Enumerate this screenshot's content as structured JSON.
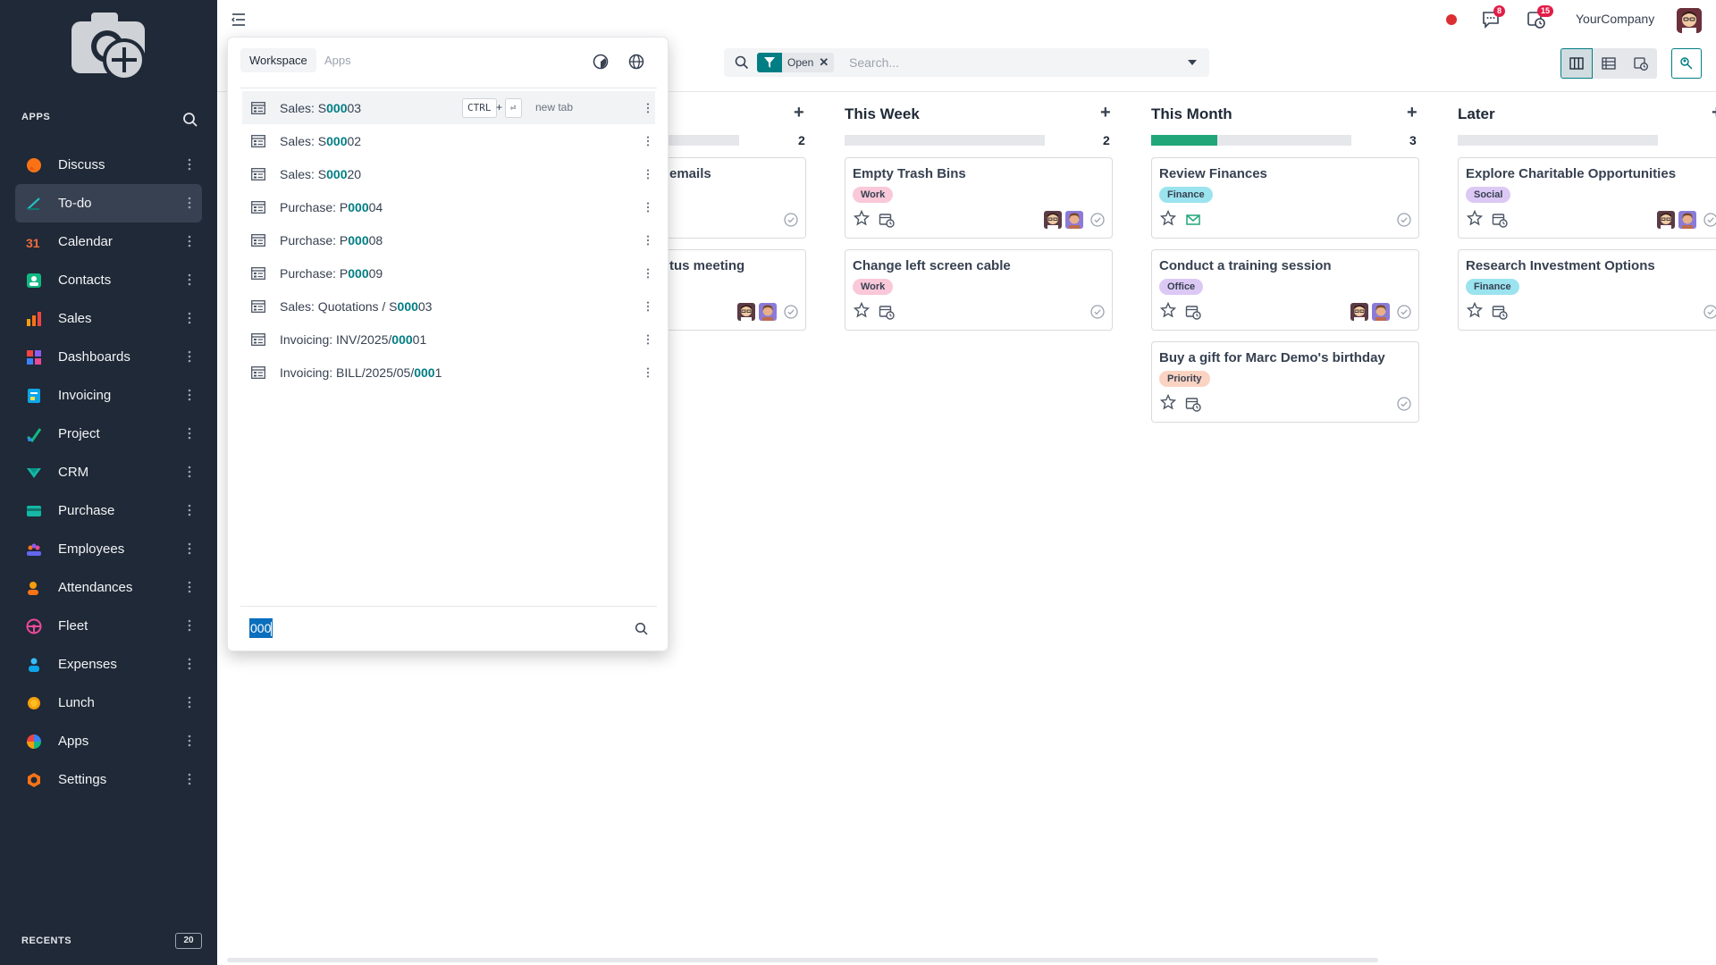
{
  "sidebar": {
    "apps_heading": "APPS",
    "recents_label": "RECENTS",
    "recents_count": "20",
    "items": [
      {
        "label": "Discuss",
        "icon": "discuss-icon"
      },
      {
        "label": "To-do",
        "icon": "todo-icon",
        "active": true
      },
      {
        "label": "Calendar",
        "icon": "calendar-icon"
      },
      {
        "label": "Contacts",
        "icon": "contacts-icon"
      },
      {
        "label": "Sales",
        "icon": "sales-icon"
      },
      {
        "label": "Dashboards",
        "icon": "dashboards-icon"
      },
      {
        "label": "Invoicing",
        "icon": "invoicing-icon"
      },
      {
        "label": "Project",
        "icon": "project-icon"
      },
      {
        "label": "CRM",
        "icon": "crm-icon"
      },
      {
        "label": "Purchase",
        "icon": "purchase-icon"
      },
      {
        "label": "Employees",
        "icon": "employees-icon"
      },
      {
        "label": "Attendances",
        "icon": "attendances-icon"
      },
      {
        "label": "Fleet",
        "icon": "fleet-icon"
      },
      {
        "label": "Expenses",
        "icon": "expenses-icon"
      },
      {
        "label": "Lunch",
        "icon": "lunch-icon"
      },
      {
        "label": "Apps",
        "icon": "apps-icon"
      },
      {
        "label": "Settings",
        "icon": "settings-icon"
      }
    ]
  },
  "topbar": {
    "messages_badge": "8",
    "activities_badge": "15",
    "company": "YourCompany"
  },
  "search": {
    "facet": "Open",
    "facet_remove": "✕",
    "placeholder": "Search..."
  },
  "palette": {
    "tab_workspace": "Workspace",
    "tab_apps": "Apps",
    "kbd_ctrl": "CTRL",
    "kbd_plus": "+",
    "kbd_enter": "⏎",
    "new_tab": "new tab",
    "query": "000",
    "results": [
      {
        "pre": "Sales: S",
        "hl": "000",
        "post": "03"
      },
      {
        "pre": "Sales: S",
        "hl": "000",
        "post": "02"
      },
      {
        "pre": "Sales: S",
        "hl": "000",
        "post": "20"
      },
      {
        "pre": "Purchase: P",
        "hl": "000",
        "post": "04"
      },
      {
        "pre": "Purchase: P",
        "hl": "000",
        "post": "08"
      },
      {
        "pre": "Purchase: P",
        "hl": "000",
        "post": "09"
      },
      {
        "pre": "Sales: Quotations / S",
        "hl": "000",
        "post": "03"
      },
      {
        "pre": "Invoicing: INV/2025/",
        "hl": "000",
        "post": "01"
      },
      {
        "pre": "Invoicing: BILL/2025/05/",
        "hl": "000",
        "post": "1"
      }
    ]
  },
  "kanban": {
    "columns": [
      {
        "title": "",
        "count": "2",
        "progress": 0,
        "cards": [
          {
            "title": "emails",
            "tag": "",
            "tag_color": ""
          },
          {
            "title": "tus meeting",
            "tag": "",
            "tag_color": "",
            "avatars": 2
          }
        ]
      },
      {
        "title": "This Week",
        "count": "2",
        "progress": 0,
        "cards": [
          {
            "title": "Empty Trash Bins",
            "tag": "Work",
            "tag_color": "#f9c8d9",
            "avatars": 2
          },
          {
            "title": "Change left screen cable",
            "tag": "Work",
            "tag_color": "#f9c8d9"
          }
        ]
      },
      {
        "title": "This Month",
        "count": "3",
        "progress": 0.33,
        "cards": [
          {
            "title": "Review Finances",
            "tag": "Finance",
            "tag_color": "#9be3ef",
            "mail": true
          },
          {
            "title": "Conduct a training session",
            "tag": "Office",
            "tag_color": "#dcc8f5",
            "avatars": 2
          },
          {
            "title": "Buy a gift for Marc Demo's birthday",
            "tag": "Priority",
            "tag_color": "#fbd3c2"
          }
        ]
      },
      {
        "title": "Later",
        "count": "",
        "progress": 0,
        "cards": [
          {
            "title": "Explore Charitable Opportunities",
            "tag": "Social",
            "tag_color": "#dcc8f5",
            "avatars": 2
          },
          {
            "title": "Research Investment Options",
            "tag": "Finance",
            "tag_color": "#9be3ef"
          }
        ]
      }
    ]
  },
  "colors": {
    "accent": "#017e84",
    "sidebar_bg": "#1f2937",
    "progress_green": "#21a67a",
    "badge_red": "#e11d48"
  }
}
